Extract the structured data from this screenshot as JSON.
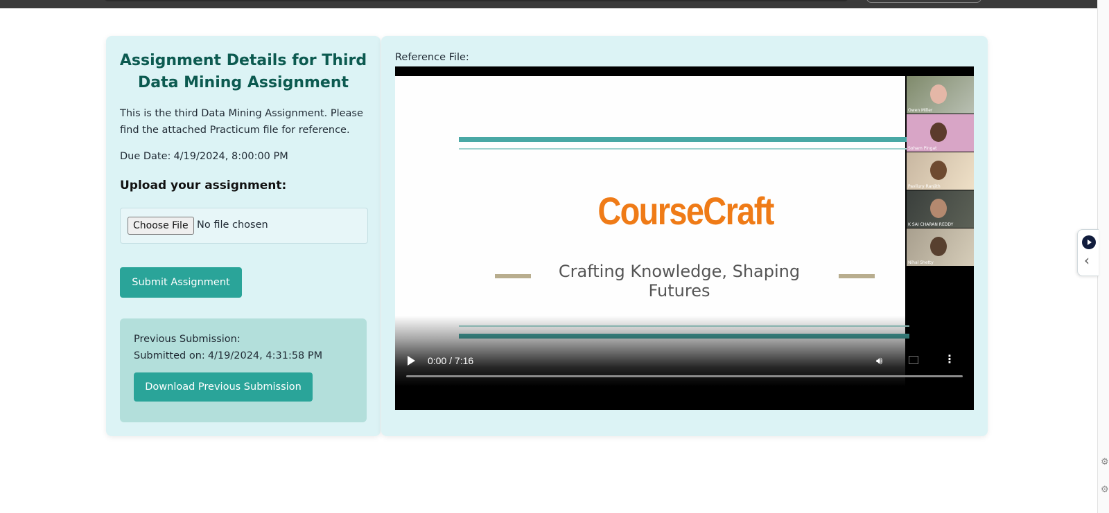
{
  "assignment": {
    "title": "Assignment Details for Third Data Mining Assignment",
    "description": "This is the third Data Mining Assignment. Please find the attached Practicum file for reference.",
    "due_label": "Due Date:",
    "due_value": "4/19/2024, 8:00:00 PM"
  },
  "upload": {
    "label": "Upload your assignment:",
    "choose_file_label": "Choose File",
    "file_status": "No file chosen",
    "submit_label": "Submit Assignment"
  },
  "previous": {
    "heading": "Previous Submission:",
    "submitted_label": "Submitted on:",
    "submitted_value": "4/19/2024, 4:31:58 PM",
    "download_label": "Download Previous Submission"
  },
  "reference": {
    "label": "Reference File:",
    "slide_brand": "CourseCraft",
    "slide_tagline": "Crafting Knowledge, Shaping Futures",
    "participants": [
      "Owen Miller",
      "Soham Pingat",
      "Pavilury Ranjith",
      "K SAI CHARAN REDDY",
      "Nihal Shetty"
    ],
    "player": {
      "current_time": "0:00",
      "duration": "7:16",
      "progress": 0
    }
  },
  "icons": {
    "play": "play-icon",
    "volume": "volume-icon",
    "fullscreen": "fullscreen-icon",
    "more": "more-options-icon"
  },
  "colors": {
    "accent": "#2aa499",
    "card_bg": "#dcf3f5",
    "prev_box_bg": "#b3dfdb",
    "title": "#0c5a50",
    "brand_orange": "#ef7b17"
  }
}
